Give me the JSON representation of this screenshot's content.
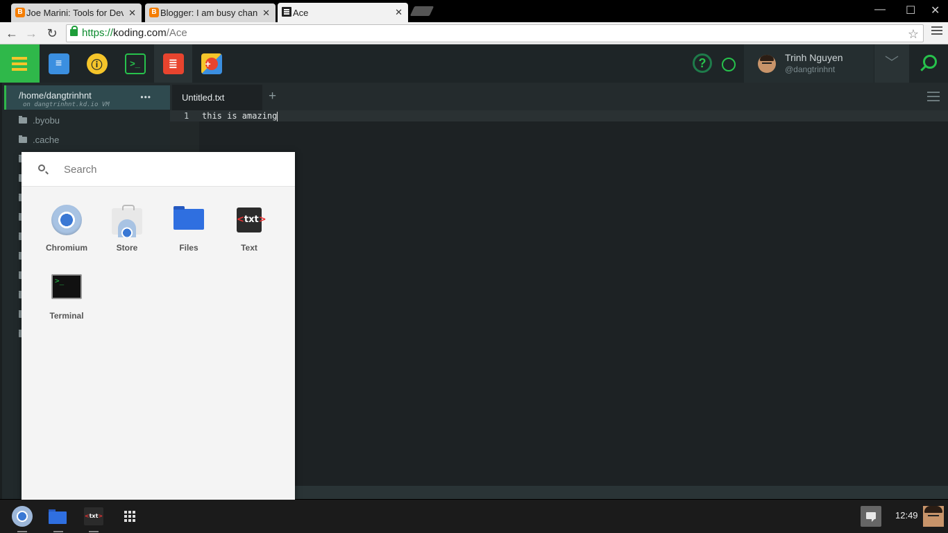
{
  "browser": {
    "tabs": [
      {
        "title": "Joe Marini: Tools for Dev",
        "favicon": "blogger-icon",
        "active": false
      },
      {
        "title": "Blogger: I am busy chang",
        "favicon": "blogger-icon",
        "active": false
      },
      {
        "title": "Ace",
        "favicon": "ace-editor-icon",
        "active": true
      }
    ],
    "tab_close_glyph": "✕",
    "window_controls": {
      "minimize": "—",
      "maximize": "☐",
      "close": "✕"
    },
    "url": {
      "scheme": "https://",
      "host": "koding.com",
      "path": "/Ace"
    },
    "nav": {
      "back": "←",
      "forward": "→",
      "reload": "↻"
    },
    "bookmark_glyph": "☆"
  },
  "koding": {
    "apps": [
      {
        "name": "activity-icon",
        "color": "#3b8fe0",
        "glyph": "≡"
      },
      {
        "name": "teamwork-icon",
        "color": "#f5c52a",
        "glyph": "ⓘ"
      },
      {
        "name": "terminal-icon",
        "color": "#27c24c",
        "glyph": ">_"
      },
      {
        "name": "ace-editor-icon",
        "color": "#e8442e",
        "glyph": "≣"
      },
      {
        "name": "app-store-icon",
        "color": "#27c24c",
        "glyph": "+"
      }
    ],
    "help_glyph": "?",
    "user": {
      "name": "Trinh Nguyen",
      "handle": "@dangtrinhnt"
    },
    "dropdown_glyph": "﹀",
    "accent": "#2fb84a"
  },
  "filetree": {
    "vm_path": "/home/dangtrinhnt",
    "vm_host": "on dangtrinhnt.kd.io VM",
    "menu_glyph": "•••",
    "items": [
      ".byobu",
      ".cache"
    ]
  },
  "editor": {
    "tab_title": "Untitled.txt",
    "add_tab_glyph": "+",
    "line_number": "1",
    "code": "this is amazing"
  },
  "launcher": {
    "search_placeholder": "Search",
    "apps": [
      {
        "label": "Chromium"
      },
      {
        "label": "Store"
      },
      {
        "label": "Files"
      },
      {
        "label": "Text"
      },
      {
        "label": "Terminal"
      }
    ],
    "text_icon": {
      "open": "<",
      "word": "txt",
      "close": ">"
    }
  },
  "shelf": {
    "clock": "12:49",
    "text_icon": {
      "open": "<",
      "word": "txt",
      "close": ">"
    }
  }
}
